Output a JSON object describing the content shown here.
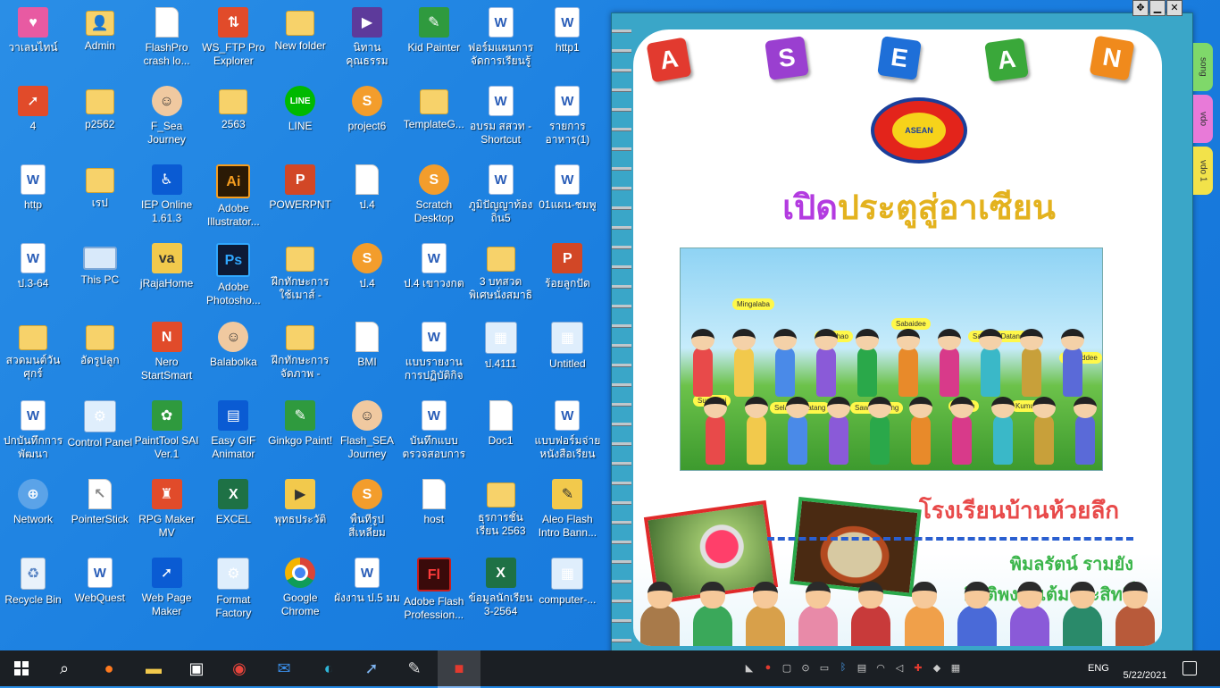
{
  "desktop": {
    "icons": [
      {
        "label": "วาเลนไทน์",
        "icon": "valentine-icon"
      },
      {
        "label": "Admin",
        "icon": "user-folder-icon"
      },
      {
        "label": "FlashPro crash lo...",
        "icon": "file-icon"
      },
      {
        "label": "WS_FTP Pro Explorer",
        "icon": "ftp-icon"
      },
      {
        "label": "New folder",
        "icon": "folder-icon"
      },
      {
        "label": "นิทานคุณธรรม",
        "icon": "video-icon"
      },
      {
        "label": "Kid Painter",
        "icon": "paint-icon"
      },
      {
        "label": "ฟอร์มแผนการจัดการเรียนรู้",
        "icon": "word-icon"
      },
      {
        "label": "http1",
        "icon": "word-icon"
      },
      {
        "label": "4",
        "icon": "shortcut-icon"
      },
      {
        "label": "p2562",
        "icon": "folder-icon"
      },
      {
        "label": "F_Sea Journey",
        "icon": "face-icon"
      },
      {
        "label": "2563",
        "icon": "folder-icon"
      },
      {
        "label": "LINE",
        "icon": "line-icon"
      },
      {
        "label": "project6",
        "icon": "scratch-icon"
      },
      {
        "label": "TemplateG...",
        "icon": "folder-icon"
      },
      {
        "label": "อบรม สสวท - Shortcut",
        "icon": "word-icon"
      },
      {
        "label": "รายการอาหาร(1)",
        "icon": "word-icon"
      },
      {
        "label": "http",
        "icon": "word-icon"
      },
      {
        "label": "เรป",
        "icon": "folder-icon"
      },
      {
        "label": "IEP Online 1.61.3",
        "icon": "accessibility-icon"
      },
      {
        "label": "Adobe Illustrator...",
        "icon": "illustrator-icon"
      },
      {
        "label": "POWERPNT",
        "icon": "powerpoint-icon"
      },
      {
        "label": "ป.4",
        "icon": "file-icon"
      },
      {
        "label": "Scratch Desktop",
        "icon": "scratch-icon"
      },
      {
        "label": "ภูมิปัญญาท้องถิ่น5",
        "icon": "word-icon"
      },
      {
        "label": "01แผน-ชมพู",
        "icon": "word-icon"
      },
      {
        "label": "ป.3-64",
        "icon": "word-icon"
      },
      {
        "label": "This PC",
        "icon": "computer-icon"
      },
      {
        "label": "jRajaHome",
        "icon": "letters-icon"
      },
      {
        "label": "Adobe Photosho...",
        "icon": "photoshop-icon"
      },
      {
        "label": "ฝึกทักษะการใช้เมาส์ - Shor...",
        "icon": "folder-icon"
      },
      {
        "label": "ป.4",
        "icon": "scratch-icon"
      },
      {
        "label": "ป.4 เขาวงกต",
        "icon": "word-icon"
      },
      {
        "label": "3 บทสวดพิเศษนั่งสมาธิ",
        "icon": "folder-icon"
      },
      {
        "label": "ร้อยลูกปัด",
        "icon": "powerpoint-icon"
      },
      {
        "label": "สวดมนต์วันศุกร์",
        "icon": "folder-icon"
      },
      {
        "label": "อัดรูปลูก",
        "icon": "folder-icon"
      },
      {
        "label": "Nero StartSmart",
        "icon": "nero-icon"
      },
      {
        "label": "Balabolka",
        "icon": "face-icon"
      },
      {
        "label": "ฝึกทักษะการจัดภาพ - Short...",
        "icon": "folder-icon"
      },
      {
        "label": "BMI",
        "icon": "file-icon"
      },
      {
        "label": "แบบรายงานการปฏิบัติกิจกรร...",
        "icon": "word-icon"
      },
      {
        "label": "ป.4111",
        "icon": "image-icon"
      },
      {
        "label": "Untitled",
        "icon": "image-icon"
      },
      {
        "label": "ปกบันทึกการพัฒนาบุคลากร",
        "icon": "word-icon"
      },
      {
        "label": "Control Panel",
        "icon": "control-panel-icon"
      },
      {
        "label": "PaintTool SAI Ver.1",
        "icon": "painttool-icon"
      },
      {
        "label": "Easy GIF Animator",
        "icon": "film-icon"
      },
      {
        "label": "Ginkgo Paint!",
        "icon": "paint-icon"
      },
      {
        "label": "Flash_SEA Journey",
        "icon": "face-icon"
      },
      {
        "label": "บันทึกแบบตรวจสอบการจัดกร...",
        "icon": "word-icon"
      },
      {
        "label": "Doc1",
        "icon": "file-icon"
      },
      {
        "label": "แบบฟอร์มจ่ายหนังสือเรียน ป.3",
        "icon": "word-icon"
      },
      {
        "label": "Network",
        "icon": "network-icon"
      },
      {
        "label": "PointerStick",
        "icon": "pointer-icon"
      },
      {
        "label": "RPG Maker MV",
        "icon": "rpg-icon"
      },
      {
        "label": "EXCEL",
        "icon": "excel-icon"
      },
      {
        "label": "พุทธประวัติ",
        "icon": "media-icon"
      },
      {
        "label": "พื้นที่รูปสี่เหลี่ยม",
        "icon": "scratch-icon"
      },
      {
        "label": "host",
        "icon": "file-icon"
      },
      {
        "label": "ธุรการชั้นเรียน 2563",
        "icon": "folder-icon"
      },
      {
        "label": "Aleo Flash Intro Bann...",
        "icon": "pen-icon"
      },
      {
        "label": "Recycle Bin",
        "icon": "recycle-bin-icon"
      },
      {
        "label": "WebQuest",
        "icon": "word-icon"
      },
      {
        "label": "Web Page Maker",
        "icon": "cursor-icon"
      },
      {
        "label": "Format Factory",
        "icon": "factory-icon"
      },
      {
        "label": "Google Chrome",
        "icon": "chrome-icon"
      },
      {
        "label": "ผังงาน ป.5 มม",
        "icon": "word-icon"
      },
      {
        "label": "Adobe Flash Profession...",
        "icon": "flash-icon"
      },
      {
        "label": "ข้อมูลนักเรียน 3-2564",
        "icon": "excel-icon"
      },
      {
        "label": "computer-...",
        "icon": "image-icon"
      }
    ]
  },
  "asean_window": {
    "letters": [
      "A",
      "S",
      "E",
      "A",
      "N"
    ],
    "letter_colors": [
      "#e23a2f",
      "#9a3fd0",
      "#1e6fd8",
      "#3aa83a",
      "#f08a1c"
    ],
    "logo_text": "ASEAN",
    "title_accent": "เปิด",
    "title_rest": "ประตูสู่อาเซียน",
    "greetings": [
      "Mingalaba",
      "Xin Chao",
      "Sabaidee",
      "Salamat Datang",
      "Sawaddee",
      "Sua Sdei",
      "Selamat Datang",
      "Sawatdi Sung",
      "Ni Hao",
      "Kumusta"
    ],
    "school_name": "โรงเรียนบ้านห้วยลึก",
    "author1": "พิมลรัตน์ รามยัง",
    "author2": "กิตติพงศ์ แต้มประสิทธิ์",
    "side_tabs": [
      "song",
      "vdo",
      "vdo 1"
    ],
    "side_tab_colors": [
      "#7fd86a",
      "#e87ad8",
      "#f2e24a"
    ],
    "controls": {
      "move": "✥",
      "minimize": "▁",
      "close": "✕"
    }
  },
  "taskbar": {
    "apps": [
      "search-icon",
      "firefox-icon",
      "file-explorer-icon",
      "store-icon",
      "chrome-icon",
      "mail-icon",
      "edge-icon",
      "web-page-maker-icon",
      "painttool-icon",
      "asean-app-icon"
    ],
    "language": "ENG",
    "date": "5/22/2021"
  }
}
